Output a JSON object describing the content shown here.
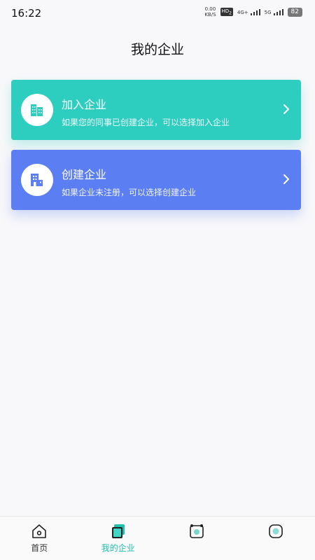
{
  "status_bar": {
    "time": "16:22",
    "net_speed_value": "0.00",
    "net_speed_unit": "KB/S",
    "hd_label": "HD",
    "hd_num": "2",
    "signal_4g": "4G+",
    "signal_5g": "5G",
    "battery": "82"
  },
  "page": {
    "title": "我的企业"
  },
  "cards": [
    {
      "title": "加入企业",
      "subtitle": "如果您的同事已创建企业，可以选择加入企业",
      "icon": "building-icon",
      "color": "#2dcebf"
    },
    {
      "title": "创建企业",
      "subtitle": "如果企业未注册，可以选择创建企业",
      "icon": "building-add-icon",
      "color": "#5b7ef2"
    }
  ],
  "tabs": [
    {
      "label": "首页",
      "icon": "home-icon",
      "active": false
    },
    {
      "label": "我的企业",
      "icon": "enterprise-icon",
      "active": true
    },
    {
      "label": "",
      "icon": "alarm-icon",
      "active": false
    },
    {
      "label": "",
      "icon": "profile-icon",
      "active": false
    }
  ],
  "colors": {
    "accent": "#1fbfb0",
    "join_card": "#2dcebf",
    "create_card": "#5b7ef2"
  }
}
